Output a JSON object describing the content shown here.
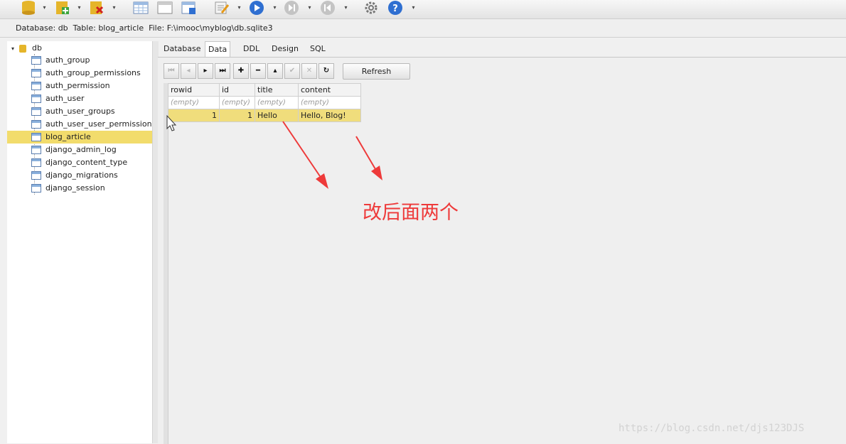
{
  "path_bar": {
    "database_label": "Database:",
    "database": "db",
    "table_label": "Table:",
    "table": "blog_article",
    "file_label": "File:",
    "file": "F:\\imooc\\myblog\\db.sqlite3"
  },
  "tree": {
    "root": "db",
    "items": [
      "auth_group",
      "auth_group_permissions",
      "auth_permission",
      "auth_user",
      "auth_user_groups",
      "auth_user_user_permission",
      "blog_article",
      "django_admin_log",
      "django_content_type",
      "django_migrations",
      "django_session"
    ],
    "selected": "blog_article"
  },
  "tabs": [
    "Database",
    "Data",
    "DDL",
    "Design",
    "SQL"
  ],
  "active_tab": "Data",
  "refresh_label": "Refresh",
  "grid": {
    "columns": [
      "rowid",
      "id",
      "title",
      "content"
    ],
    "filters": [
      "(empty)",
      "(empty)",
      "(empty)",
      "(empty)"
    ],
    "rows": [
      [
        "1",
        "1",
        "Hello",
        "Hello, Blog!"
      ]
    ]
  },
  "annotation": "改后面两个",
  "watermark": "https://blog.csdn.net/djs123DJS",
  "colors": {
    "selection": "#f2dc6c",
    "annotation": "#ee3a3a",
    "accent_blue": "#2f6fd1"
  }
}
